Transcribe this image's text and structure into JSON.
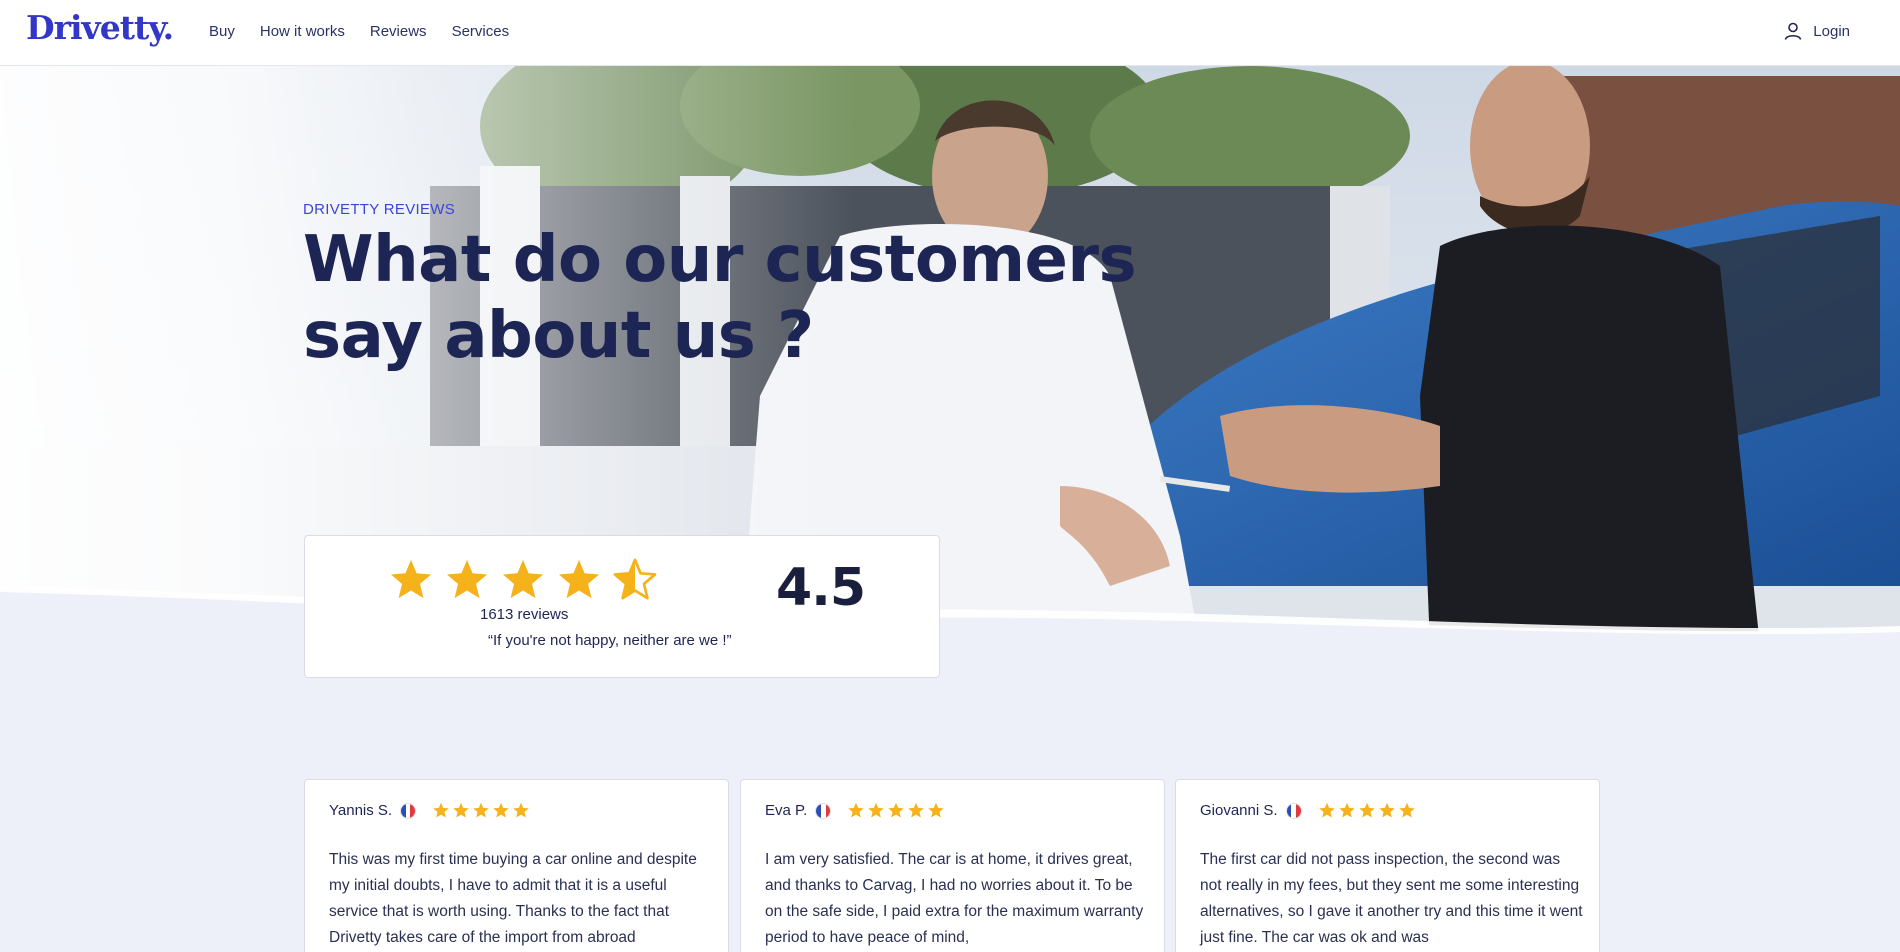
{
  "header": {
    "logo": "Drivetty",
    "logo_dot": ".",
    "nav": [
      "Buy",
      "How it works",
      "Reviews",
      "Services"
    ],
    "login_label": "Login"
  },
  "hero": {
    "eyebrow": "DRIVETTY REVIEWS",
    "title": "What do our customers say about us ?"
  },
  "rating": {
    "stars": 4.5,
    "score": "4.5",
    "reviews_count": "1613 reviews",
    "quote": "“If you're not happy, neither are we !”"
  },
  "reviews": [
    {
      "name": "Yannis S.",
      "flag": "fr",
      "stars": 5,
      "text": "This was my first time buying a car online and despite my initial doubts, I have to admit that it is a useful service that is worth using. Thanks to the fact that Drivetty takes care of the import from abroad"
    },
    {
      "name": "Eva P.",
      "flag": "fr",
      "stars": 5,
      "text": "I am very satisfied. The car is at home, it drives great, and thanks to Carvag, I had no worries about it. To be on the safe side, I paid extra for the maximum warranty period to have peace of mind,"
    },
    {
      "name": "Giovanni S.",
      "flag": "fr",
      "stars": 5,
      "text": "The first car did not pass inspection, the second was not really in my fees, but they sent me some interesting alternatives, so I gave it another try and this time it went just fine. The car was ok and was"
    }
  ],
  "colors": {
    "brand": "#3237c6",
    "navy": "#1d2554",
    "star": "#f6b21a",
    "page_bg": "#edf0f8"
  }
}
